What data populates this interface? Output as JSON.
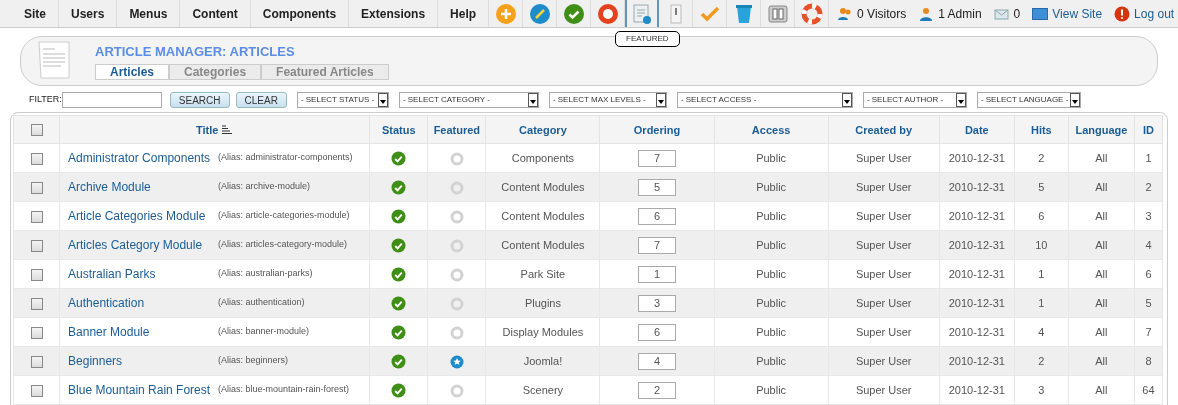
{
  "menu": [
    "Site",
    "Users",
    "Menus",
    "Content",
    "Components",
    "Extensions",
    "Help"
  ],
  "toolbar": [
    {
      "kind": "add"
    },
    {
      "kind": "edit"
    },
    {
      "kind": "publish"
    },
    {
      "kind": "unpublish"
    },
    {
      "kind": "featured",
      "tooltip": "FEATURED"
    },
    {
      "kind": "archive"
    },
    {
      "kind": "checkin"
    },
    {
      "kind": "trash"
    },
    {
      "kind": "options"
    },
    {
      "kind": "help"
    }
  ],
  "status": [
    {
      "kind": "visitors",
      "text": "0 Visitors"
    },
    {
      "kind": "admins",
      "text": "1 Admin"
    },
    {
      "kind": "messages",
      "text": "0"
    },
    {
      "kind": "view",
      "text": "View Site"
    },
    {
      "kind": "logout",
      "text": "Log out"
    }
  ],
  "header": {
    "title": "ARTICLE MANAGER: ARTICLES",
    "tabs": [
      {
        "label": "Articles",
        "selected": true
      },
      {
        "label": "Categories",
        "selected": false
      },
      {
        "label": "Featured Articles",
        "selected": false
      }
    ]
  },
  "filter": {
    "label": "FILTER:",
    "search": "SEARCH",
    "clear": "CLEAR",
    "selects": [
      "- SELECT STATUS -",
      "- SELECT CATEGORY -",
      "- SELECT MAX LEVELS -",
      "- SELECT ACCESS -",
      "- SELECT AUTHOR -",
      "- SELECT LANGUAGE -"
    ]
  },
  "table": {
    "all_checked": false,
    "columns": [
      "Title",
      "Status",
      "Featured",
      "Category",
      "Ordering",
      "Access",
      "Created by",
      "Date",
      "Hits",
      "Language",
      "ID"
    ],
    "rows": [
      {
        "checked": false,
        "title": "Administrator Components",
        "alias": "(Alias: administrator-components)",
        "published": true,
        "featured": false,
        "category": "Components",
        "ordering": "7",
        "access": "Public",
        "created_by": "Super User",
        "date": "2010-12-31",
        "hits": "2",
        "language": "All",
        "id": "1"
      },
      {
        "checked": false,
        "title": "Archive Module",
        "alias": "(Alias: archive-module)",
        "published": true,
        "featured": false,
        "category": "Content Modules",
        "ordering": "5",
        "access": "Public",
        "created_by": "Super User",
        "date": "2010-12-31",
        "hits": "5",
        "language": "All",
        "id": "2"
      },
      {
        "checked": false,
        "title": "Article Categories Module",
        "alias": "(Alias: article-categories-module)",
        "published": true,
        "featured": false,
        "category": "Content Modules",
        "ordering": "6",
        "access": "Public",
        "created_by": "Super User",
        "date": "2010-12-31",
        "hits": "6",
        "language": "All",
        "id": "3"
      },
      {
        "checked": false,
        "title": "Articles Category Module",
        "alias": "(Alias: articles-category-module)",
        "published": true,
        "featured": false,
        "category": "Content Modules",
        "ordering": "7",
        "access": "Public",
        "created_by": "Super User",
        "date": "2010-12-31",
        "hits": "10",
        "language": "All",
        "id": "4"
      },
      {
        "checked": false,
        "title": "Australian Parks",
        "alias": "(Alias: australian-parks)",
        "published": true,
        "featured": false,
        "category": "Park Site",
        "ordering": "1",
        "access": "Public",
        "created_by": "Super User",
        "date": "2010-12-31",
        "hits": "1",
        "language": "All",
        "id": "6"
      },
      {
        "checked": false,
        "title": "Authentication",
        "alias": "(Alias: authentication)",
        "published": true,
        "featured": false,
        "category": "Plugins",
        "ordering": "3",
        "access": "Public",
        "created_by": "Super User",
        "date": "2010-12-31",
        "hits": "1",
        "language": "All",
        "id": "5"
      },
      {
        "checked": false,
        "title": "Banner Module",
        "alias": "(Alias: banner-module)",
        "published": true,
        "featured": false,
        "category": "Display Modules",
        "ordering": "6",
        "access": "Public",
        "created_by": "Super User",
        "date": "2010-12-31",
        "hits": "4",
        "language": "All",
        "id": "7"
      },
      {
        "checked": false,
        "title": "Beginners",
        "alias": "(Alias: beginners)",
        "published": true,
        "featured": true,
        "category": "Joomla!",
        "ordering": "4",
        "access": "Public",
        "created_by": "Super User",
        "date": "2010-12-31",
        "hits": "2",
        "language": "All",
        "id": "8"
      },
      {
        "checked": false,
        "title": "Blue Mountain Rain Forest",
        "alias": "(Alias: blue-mountain-rain-forest)",
        "published": true,
        "featured": false,
        "category": "Scenery",
        "ordering": "2",
        "access": "Public",
        "created_by": "Super User",
        "date": "2010-12-31",
        "hits": "3",
        "language": "All",
        "id": "64"
      }
    ]
  }
}
